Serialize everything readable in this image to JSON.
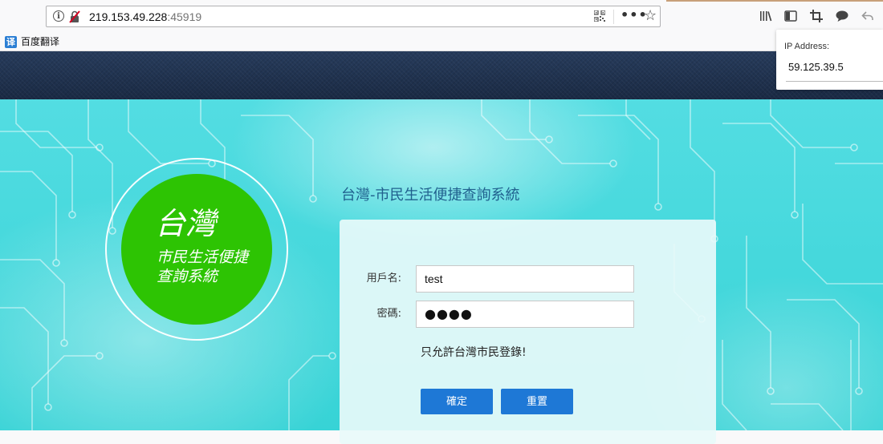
{
  "browser": {
    "url_host": "219.153.49.228",
    "url_port": ":45919",
    "icons": [
      "info-icon",
      "insecure-lock-icon",
      "qr-code-icon",
      "page-actions-icon",
      "bookmark-star-icon",
      "library-icon",
      "sidebar-icon",
      "screenshot-icon",
      "chat-icon",
      "back-icon"
    ],
    "bookmark": {
      "icon_text": "译",
      "label": "百度翻译",
      "icon_color": "#2b7fd4"
    }
  },
  "popup": {
    "label": "IP Address:",
    "value": "59.125.39.5"
  },
  "logo": {
    "big": "台灣",
    "line1": "市民生活便捷",
    "line2": "查詢系統",
    "color": "#2dc403"
  },
  "system_title": "台灣-市民生活便捷查詢系統",
  "form": {
    "username_label": "用戶名:",
    "username_value": "test",
    "password_label": "密碼:",
    "password_mask": "●●●●",
    "note": "只允許台灣市民登錄!",
    "submit_label": "確定",
    "reset_label": "重置",
    "button_color": "#1e78d6"
  }
}
